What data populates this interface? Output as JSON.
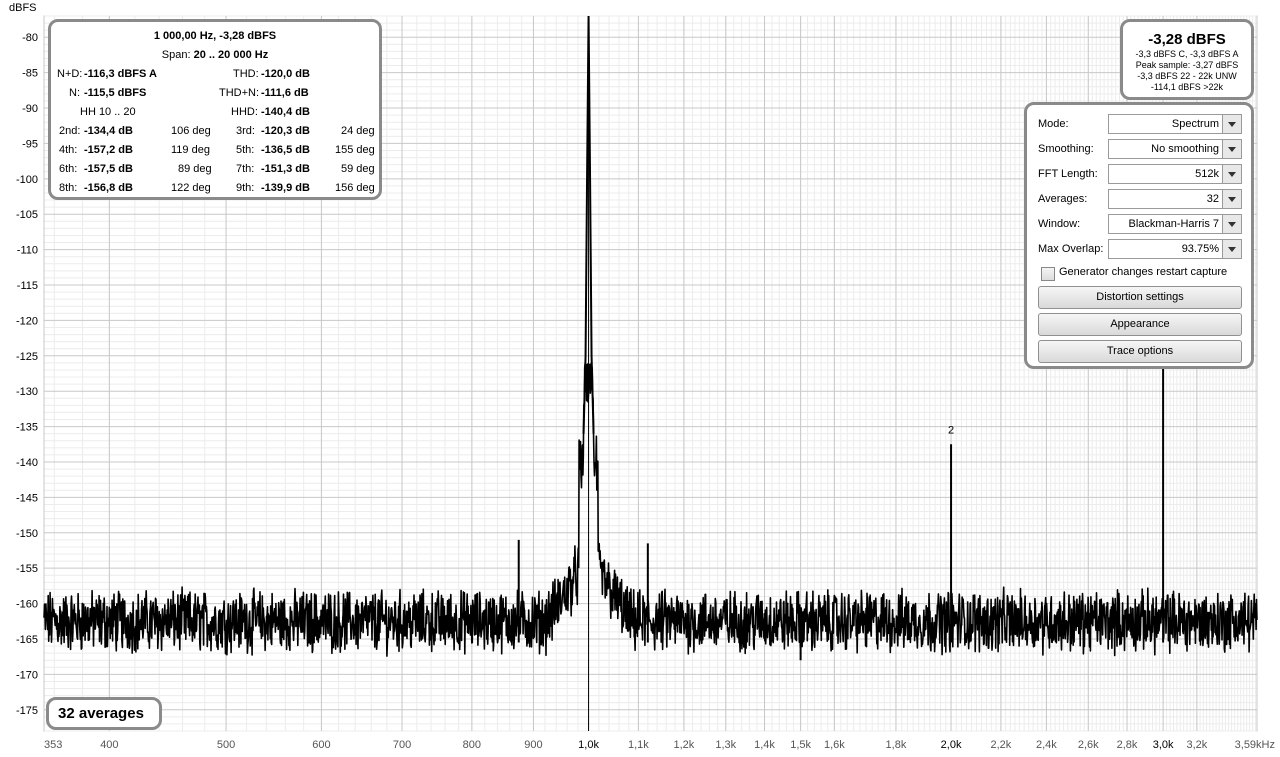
{
  "app": {
    "unit_label": "dBFS"
  },
  "distortion": {
    "title": "1 000,00 Hz, -3,28 dBFS",
    "span_label": "Span:",
    "span_value": "20 .. 20 000 Hz",
    "nd_label": "N+D:",
    "nd_value": "-116,3 dBFS A",
    "thd_label": "THD:",
    "thd_value": "-120,0 dB",
    "n_label": "N:",
    "n_value": "-115,5 dBFS",
    "thdn_label": "THD+N:",
    "thdn_value": "-111,6 dB",
    "hh_label": "HH 10 .. 20",
    "hhd_label": "HHD:",
    "hhd_value": "-140,4 dB",
    "harmonics": [
      {
        "l1": "2nd:",
        "v1": "-134,4 dB",
        "d1": "106 deg",
        "l2": "3rd:",
        "v2": "-120,3 dB",
        "d2": "24 deg"
      },
      {
        "l1": "4th:",
        "v1": "-157,2 dB",
        "d1": "119 deg",
        "l2": "5th:",
        "v2": "-136,5 dB",
        "d2": "155 deg"
      },
      {
        "l1": "6th:",
        "v1": "-157,5 dB",
        "d1": "89 deg",
        "l2": "7th:",
        "v2": "-151,3 dB",
        "d2": "59 deg"
      },
      {
        "l1": "8th:",
        "v1": "-156,8 dB",
        "d1": "122 deg",
        "l2": "9th:",
        "v2": "-139,9 dB",
        "d2": "156 deg"
      }
    ]
  },
  "level": {
    "main": "-3,28 dBFS",
    "line1": "-3,3 dBFS C, -3,3 dBFS A",
    "line2": "Peak sample: -3,27 dBFS",
    "line3": "-3,3 dBFS 22 - 22k UNW",
    "line4": "-114,1 dBFS >22k"
  },
  "controls": {
    "mode": {
      "label": "Mode:",
      "value": "Spectrum"
    },
    "smoothing": {
      "label": "Smoothing:",
      "value": "No  smoothing"
    },
    "fft": {
      "label": "FFT Length:",
      "value": "512k"
    },
    "averages": {
      "label": "Averages:",
      "value": "32"
    },
    "window": {
      "label": "Window:",
      "value": "Blackman-Harris 7"
    },
    "overlap": {
      "label": "Max Overlap:",
      "value": "93.75%"
    },
    "generator_restart": {
      "label": "Generator changes restart capture",
      "checked": false
    },
    "distortion_settings": "Distortion settings",
    "appearance": "Appearance",
    "trace_options": "Trace options"
  },
  "status": {
    "averages_label": "32 averages"
  },
  "chart_data": {
    "type": "line",
    "ylabel": "dBFS",
    "ylim": [
      -178,
      -77
    ],
    "xlim": [
      353,
      3590
    ],
    "x_scale": "log",
    "grid": true,
    "y_ticks": [
      -80,
      -85,
      -90,
      -95,
      -100,
      -105,
      -110,
      -115,
      -120,
      -125,
      -130,
      -135,
      -140,
      -145,
      -150,
      -155,
      -160,
      -165,
      -170,
      -175
    ],
    "y_tick_labels": [
      "-80",
      "-85",
      "-90",
      "-95",
      "-100",
      "-105",
      "-110",
      "-115",
      "-120",
      "-125",
      "-130",
      "-135",
      "-140",
      "-145",
      "-150",
      "-155",
      "-160",
      "-165",
      "-170",
      "-175"
    ],
    "x_ticks": [
      353,
      400,
      500,
      600,
      700,
      800,
      900,
      1000,
      1100,
      1200,
      1300,
      1400,
      1500,
      1600,
      1800,
      2000,
      2200,
      2400,
      2600,
      2800,
      3000,
      3200,
      3590
    ],
    "x_tick_labels": [
      "353",
      "400",
      "500",
      "600",
      "700",
      "800",
      "900",
      "1,0k",
      "1,1k",
      "1,2k",
      "1,3k",
      "1,4k",
      "1,5k",
      "1,6k",
      "1,8k",
      "2,0k",
      "2,2k",
      "2,4k",
      "2,6k",
      "2,8k",
      "3,0k",
      "3,2k",
      "3,59kHz"
    ],
    "noise_floor": -162.5,
    "fundamental": {
      "x": 1000,
      "y": -3.28
    },
    "spurs": [
      {
        "x": 875,
        "y": -151
      },
      {
        "x": 1120,
        "y": -151.5
      },
      {
        "x": 2000,
        "y": -137.5
      },
      {
        "x": 3000,
        "y": -120.3
      },
      {
        "x": 1500,
        "y": -168
      }
    ],
    "annotations": [
      {
        "x": 2000,
        "y": -136,
        "text": "2"
      }
    ]
  }
}
